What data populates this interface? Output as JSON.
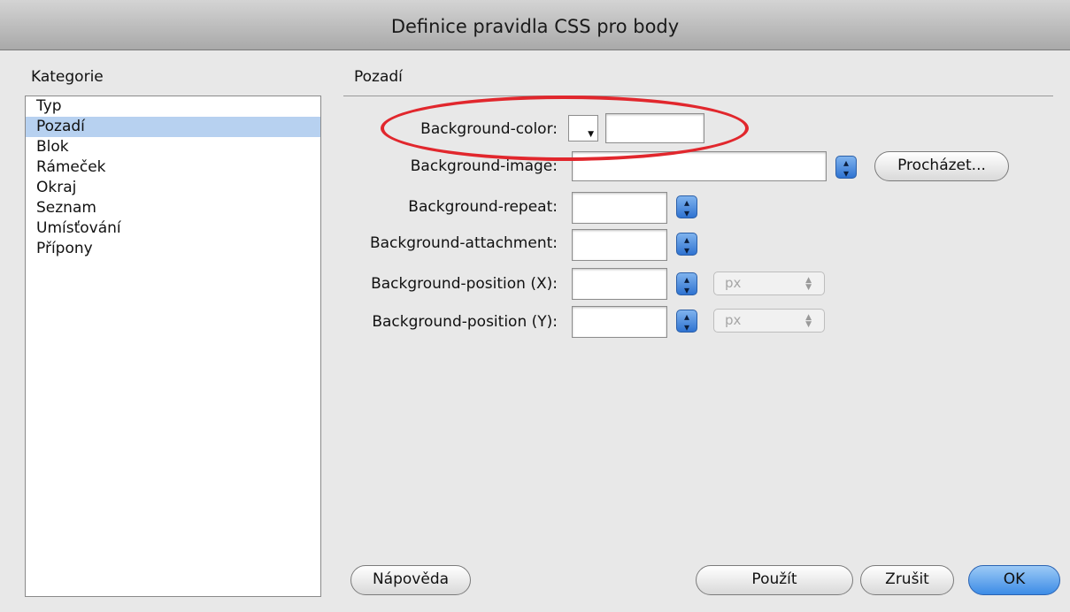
{
  "window": {
    "title": "Definice pravidla CSS pro body"
  },
  "categories": {
    "heading": "Kategorie",
    "items": [
      "Typ",
      "Pozadí",
      "Blok",
      "Rámeček",
      "Okraj",
      "Seznam",
      "Umísťování",
      "Přípony"
    ],
    "selected": "Pozadí"
  },
  "section": {
    "title": "Pozadí"
  },
  "fields": {
    "background_color": {
      "label": "Background-color:",
      "value": ""
    },
    "background_image": {
      "label": "Background-image:",
      "value": ""
    },
    "background_repeat": {
      "label": "Background-repeat:",
      "value": ""
    },
    "background_attachment": {
      "label": "Background-attachment:",
      "value": ""
    },
    "background_position_x": {
      "label": "Background-position (X):",
      "value": "",
      "unit": "px"
    },
    "background_position_y": {
      "label": "Background-position (Y):",
      "value": "",
      "unit": "px"
    }
  },
  "buttons": {
    "browse": "Procházet...",
    "help": "Nápověda",
    "apply": "Použít",
    "cancel": "Zrušit",
    "ok": "OK"
  },
  "colors": {
    "highlight_ellipse": "#e1272d",
    "selection": "#b7d1f0",
    "accent": "#3c8ce6"
  }
}
